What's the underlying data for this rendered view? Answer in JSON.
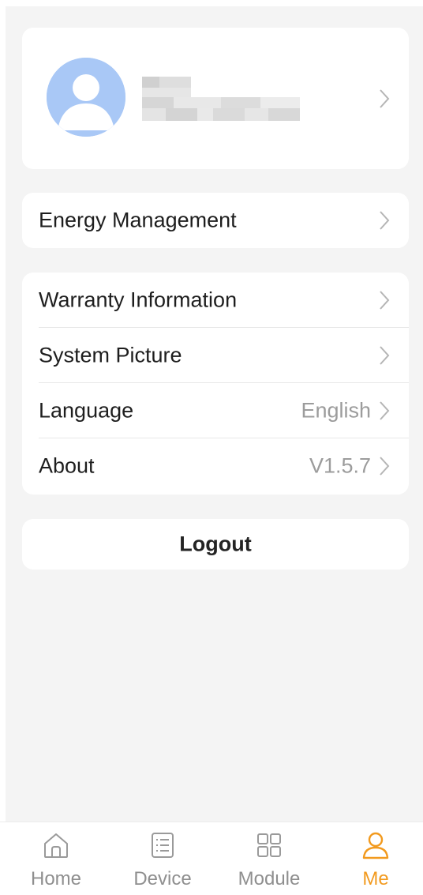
{
  "profile": {
    "name_redacted": true
  },
  "menu_primary": [
    {
      "label": "Energy Management"
    }
  ],
  "menu_settings": [
    {
      "label": "Warranty Information",
      "value": ""
    },
    {
      "label": "System Picture",
      "value": ""
    },
    {
      "label": "Language",
      "value": "English"
    },
    {
      "label": "About",
      "value": "V1.5.7"
    }
  ],
  "logout": {
    "label": "Logout"
  },
  "tabbar": {
    "tabs": [
      {
        "label": "Home",
        "icon": "home-icon",
        "active": false
      },
      {
        "label": "Device",
        "icon": "list-icon",
        "active": false
      },
      {
        "label": "Module",
        "icon": "grid-icon",
        "active": false
      },
      {
        "label": "Me",
        "icon": "user-icon",
        "active": true
      }
    ]
  },
  "colors": {
    "accent": "#f29a1e",
    "background": "#f4f4f4",
    "avatar": "#a9c8f6",
    "secondary_text": "#9c9c9c"
  }
}
